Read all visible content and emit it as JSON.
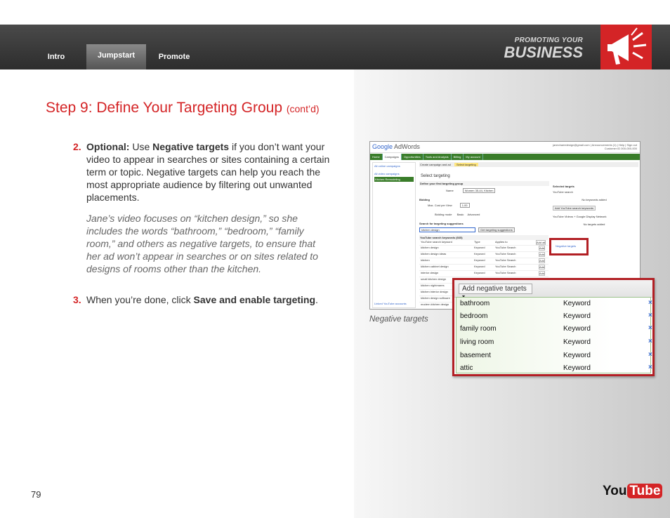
{
  "nav": {
    "tabs": [
      {
        "label": "Intro"
      },
      {
        "label": "Jumpstart"
      },
      {
        "label": "Promote"
      }
    ],
    "brand_line1": "PROMOTING YOUR",
    "brand_line2": "BUSINESS"
  },
  "content": {
    "title": "Step 9: Define Your Targeting Group",
    "title_suffix": "(cont’d)",
    "item2": {
      "number": "2.",
      "optional": "Optional:",
      "text_a": " Use ",
      "bold": "Negative targets",
      "text_b": " if you don’t want your video to appear in searches or sites containing a certain term or topic. Negative targets can help you reach the most appropriate audience by filtering out unwanted placements."
    },
    "example": "Jane’s video focuses on “kitchen design,” so she includes the words “bathroom,” “bedroom,” “family room,” and others as negative targets,  to ensure that her ad won’t appear in searches or on sites related to designs of rooms other than the kitchen.",
    "item3": {
      "number": "3.",
      "text": "When you’re done, click ",
      "bold": "Save and enable targeting",
      "end": "."
    }
  },
  "figure": {
    "caption": "Negative targets",
    "adwords": {
      "logo_google": "Google",
      "logo_adwords": "AdWords",
      "account": "janechaeedesign@gmail.com | Announcements (1) | Help | Sign out",
      "customer_id": "Customer ID 000-000-000",
      "nav_items": [
        "Home",
        "Campaigns",
        "Opportunities",
        "Tools and Analysis",
        "Billing",
        "My account"
      ],
      "sidebar": {
        "all_campaigns": "All online campaigns",
        "video_campaigns": "All video campaigns",
        "campaign": "Kitchen Remodeling",
        "linked": "Linked YouTube accounts"
      },
      "step_tabs": [
        "Create campaign and ad",
        "Select targeting"
      ],
      "select_targeting": "Select targeting",
      "define_group": "Define your first targeting group",
      "name_label": "Name",
      "name_value": "Women 35-44, Kitchen",
      "bidding": "Bidding",
      "max_cpv_label": "Max. Cost per View",
      "max_cpv_value": "1.00",
      "bidding_mode_label": "Bidding mode",
      "bidding_modes": [
        "Basic",
        "Advanced"
      ],
      "search_suggestions": "Search for targeting suggestions",
      "search_value": "kitchen design",
      "get_suggestions": "Get targeting suggestions",
      "keywords_header": "YouTube search keywords (665)",
      "columns": [
        "YouTube search keyword",
        "Type",
        "Applies to"
      ],
      "keywords": [
        {
          "term": "kitchen design",
          "type": "Keyword",
          "applies": "YouTube Search"
        },
        {
          "term": "kitchen design ideas",
          "type": "Keyword",
          "applies": "YouTube Search"
        },
        {
          "term": "kitchen",
          "type": "Keyword",
          "applies": "YouTube Search"
        },
        {
          "term": "kitchen cabinet design",
          "type": "Keyword",
          "applies": "YouTube Search"
        },
        {
          "term": "interior design",
          "type": "Keyword",
          "applies": "YouTube Search"
        },
        {
          "term": "small kitchen design",
          "type": "",
          "applies": ""
        },
        {
          "term": "kitchen nightmares",
          "type": "",
          "applies": ""
        },
        {
          "term": "kitchen interior design",
          "type": "",
          "applies": ""
        },
        {
          "term": "kitchen design software",
          "type": "",
          "applies": ""
        },
        {
          "term": "modern kitchen design",
          "type": "",
          "applies": ""
        }
      ],
      "add_all": "Add all",
      "add": "Add",
      "selected_targets": "Selected targets",
      "youtube_search": "YouTube search",
      "no_keywords": "No keywords added",
      "add_search_keywords": "Add YouTube search keywords",
      "videos_network": "YouTube Videos + Google Display Network",
      "no_targets": "No targets added",
      "negative_targets_link": "Negative targets"
    },
    "zoom": {
      "button": "Add negative targets",
      "rows": [
        {
          "term": "bathroom",
          "type": "Keyword"
        },
        {
          "term": "bedroom",
          "type": "Keyword"
        },
        {
          "term": "family room",
          "type": "Keyword"
        },
        {
          "term": "living room",
          "type": "Keyword"
        },
        {
          "term": "basement",
          "type": "Keyword"
        },
        {
          "term": "attic",
          "type": "Keyword"
        }
      ],
      "remove_glyph": "×"
    }
  },
  "footer": {
    "page_number": "79",
    "logo_you": "You",
    "logo_tube": "Tube"
  },
  "colors": {
    "accent_red": "#d42426",
    "topbar": "#3a3a3a",
    "adwords_green": "#3a7d2a",
    "link_blue": "#3366cc"
  }
}
